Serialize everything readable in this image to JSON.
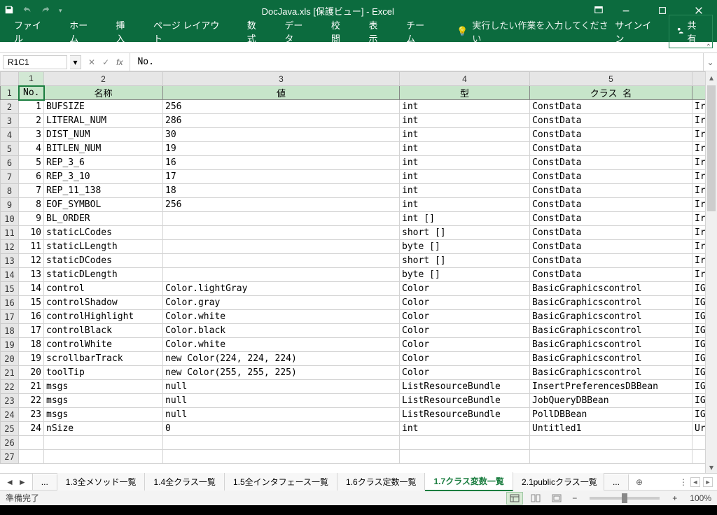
{
  "title": "DocJava.xls  [保護ビュー] - Excel",
  "qat": {
    "save": "save",
    "undo": "undo",
    "redo": "redo"
  },
  "window": {
    "ribbon_opts": "▾"
  },
  "ribbon": {
    "file": "ファイル",
    "home": "ホーム",
    "insert": "挿入",
    "layout": "ページ レイアウト",
    "formulas": "数式",
    "data": "データ",
    "review": "校閲",
    "view": "表示",
    "team": "チーム",
    "tellme_icon": "💡",
    "tellme": "実行したい作業を入力してください",
    "signin": "サインイン",
    "share": "共有"
  },
  "collapse": "⌃",
  "formula": {
    "name": "R1C1",
    "fx": "fx",
    "value": "No."
  },
  "columns": [
    "1",
    "2",
    "3",
    "4",
    "5"
  ],
  "headers": {
    "c1": "No.",
    "c2": "名称",
    "c3": "値",
    "c4": "型",
    "c5": "クラス 名"
  },
  "last_col_frag": [
    "Ir",
    "Ir",
    "Ir",
    "Ir",
    "Ir",
    "Ir",
    "Ir",
    "Ir",
    "Ir",
    "Ir",
    "Ir",
    "Ir",
    "Ir",
    "IG",
    "IG",
    "IG",
    "IG",
    "IG",
    "IG",
    "IG",
    "IG",
    "IG",
    "IG",
    "Ur"
  ],
  "rows": [
    {
      "no": "1",
      "name": "BUFSIZE",
      "val": "256",
      "type": "int",
      "cls": "ConstData"
    },
    {
      "no": "2",
      "name": "LITERAL_NUM",
      "val": "286",
      "type": "int",
      "cls": "ConstData"
    },
    {
      "no": "3",
      "name": "DIST_NUM",
      "val": "30",
      "type": "int",
      "cls": "ConstData"
    },
    {
      "no": "4",
      "name": "BITLEN_NUM",
      "val": "19",
      "type": "int",
      "cls": "ConstData"
    },
    {
      "no": "5",
      "name": "REP_3_6",
      "val": "16",
      "type": "int",
      "cls": "ConstData"
    },
    {
      "no": "6",
      "name": "REP_3_10",
      "val": "17",
      "type": "int",
      "cls": "ConstData"
    },
    {
      "no": "7",
      "name": "REP_11_138",
      "val": "18",
      "type": "int",
      "cls": "ConstData"
    },
    {
      "no": "8",
      "name": "EOF_SYMBOL",
      "val": "256",
      "type": "int",
      "cls": "ConstData"
    },
    {
      "no": "9",
      "name": "BL_ORDER",
      "val": "",
      "type": "int []",
      "cls": "ConstData"
    },
    {
      "no": "10",
      "name": "staticLCodes",
      "val": "",
      "type": "short []",
      "cls": "ConstData"
    },
    {
      "no": "11",
      "name": "staticLLength",
      "val": "",
      "type": "byte []",
      "cls": "ConstData"
    },
    {
      "no": "12",
      "name": "staticDCodes",
      "val": "",
      "type": "short []",
      "cls": "ConstData"
    },
    {
      "no": "13",
      "name": "staticDLength",
      "val": "",
      "type": "byte []",
      "cls": "ConstData"
    },
    {
      "no": "14",
      "name": "control",
      "val": "Color.lightGray",
      "type": "Color",
      "cls": "BasicGraphicscontrol"
    },
    {
      "no": "15",
      "name": "controlShadow",
      "val": "Color.gray",
      "type": "Color",
      "cls": "BasicGraphicscontrol"
    },
    {
      "no": "16",
      "name": "controlHighlight",
      "val": "Color.white",
      "type": "Color",
      "cls": "BasicGraphicscontrol"
    },
    {
      "no": "17",
      "name": "controlBlack",
      "val": "Color.black",
      "type": "Color",
      "cls": "BasicGraphicscontrol"
    },
    {
      "no": "18",
      "name": "controlWhite",
      "val": "Color.white",
      "type": "Color",
      "cls": "BasicGraphicscontrol"
    },
    {
      "no": "19",
      "name": "scrollbarTrack",
      "val": "new Color(224, 224, 224)",
      "type": "Color",
      "cls": "BasicGraphicscontrol"
    },
    {
      "no": "20",
      "name": "toolTip",
      "val": "new Color(255, 255, 225)",
      "type": "Color",
      "cls": "BasicGraphicscontrol"
    },
    {
      "no": "21",
      "name": "msgs",
      "val": "null",
      "type": "ListResourceBundle",
      "cls": "InsertPreferencesDBBean"
    },
    {
      "no": "22",
      "name": "msgs",
      "val": "null",
      "type": "ListResourceBundle",
      "cls": "JobQueryDBBean"
    },
    {
      "no": "23",
      "name": "msgs",
      "val": "null",
      "type": "ListResourceBundle",
      "cls": "PollDBBean"
    },
    {
      "no": "24",
      "name": "nSize",
      "val": "0",
      "type": "int",
      "cls": "Untitled1"
    }
  ],
  "sheets": {
    "ellipsis": "...",
    "t1": "1.3全メソッド一覧",
    "t2": "1.4全クラス一覧",
    "t3": "1.5全インタフェース一覧",
    "t4": "1.6クラス定数一覧",
    "t5": "1.7クラス変数一覧",
    "t6": "2.1publicクラス一覧",
    "more": "...",
    "add": "⊕"
  },
  "status": {
    "ready": "準備完了",
    "zoom": "100%"
  }
}
